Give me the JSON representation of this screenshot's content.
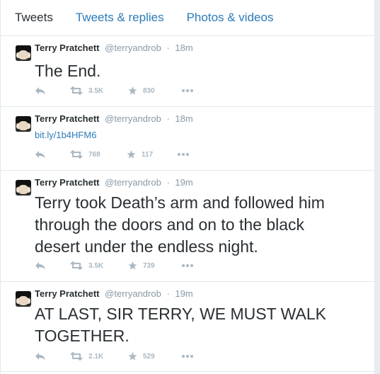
{
  "tabs": [
    {
      "label": "Tweets"
    },
    {
      "label": "Tweets & replies"
    },
    {
      "label": "Photos & videos"
    }
  ],
  "colors": {
    "link": "#2b7bb9",
    "muted": "#8899a6",
    "icon": "#aab8c2",
    "text": "#292f33"
  },
  "tweets": [
    {
      "name": "Terry Pratchett",
      "handle": "@terryandrob",
      "sep": "·",
      "time": "18m",
      "text": "The End.",
      "retweets": "3.5K",
      "favorites": "830"
    },
    {
      "name": "Terry Pratchett",
      "handle": "@terryandrob",
      "sep": "·",
      "time": "18m",
      "text": "bit.ly/1b4HFM6",
      "retweets": "768",
      "favorites": "117"
    },
    {
      "name": "Terry Pratchett",
      "handle": "@terryandrob",
      "sep": "·",
      "time": "19m",
      "text": "Terry took Death’s arm and followed him\nthrough the doors and on to the black\ndesert under the endless night.",
      "retweets": "3.5K",
      "favorites": "739"
    },
    {
      "name": "Terry Pratchett",
      "handle": "@terryandrob",
      "sep": "·",
      "time": "19m",
      "text": "AT LAST, SIR TERRY, WE MUST WALK\nTOGETHER.",
      "retweets": "2.1K",
      "favorites": "529"
    }
  ],
  "icons": {
    "reply": "reply-icon",
    "retweet": "retweet-icon",
    "favorite": "star-icon",
    "more": "more-icon"
  }
}
